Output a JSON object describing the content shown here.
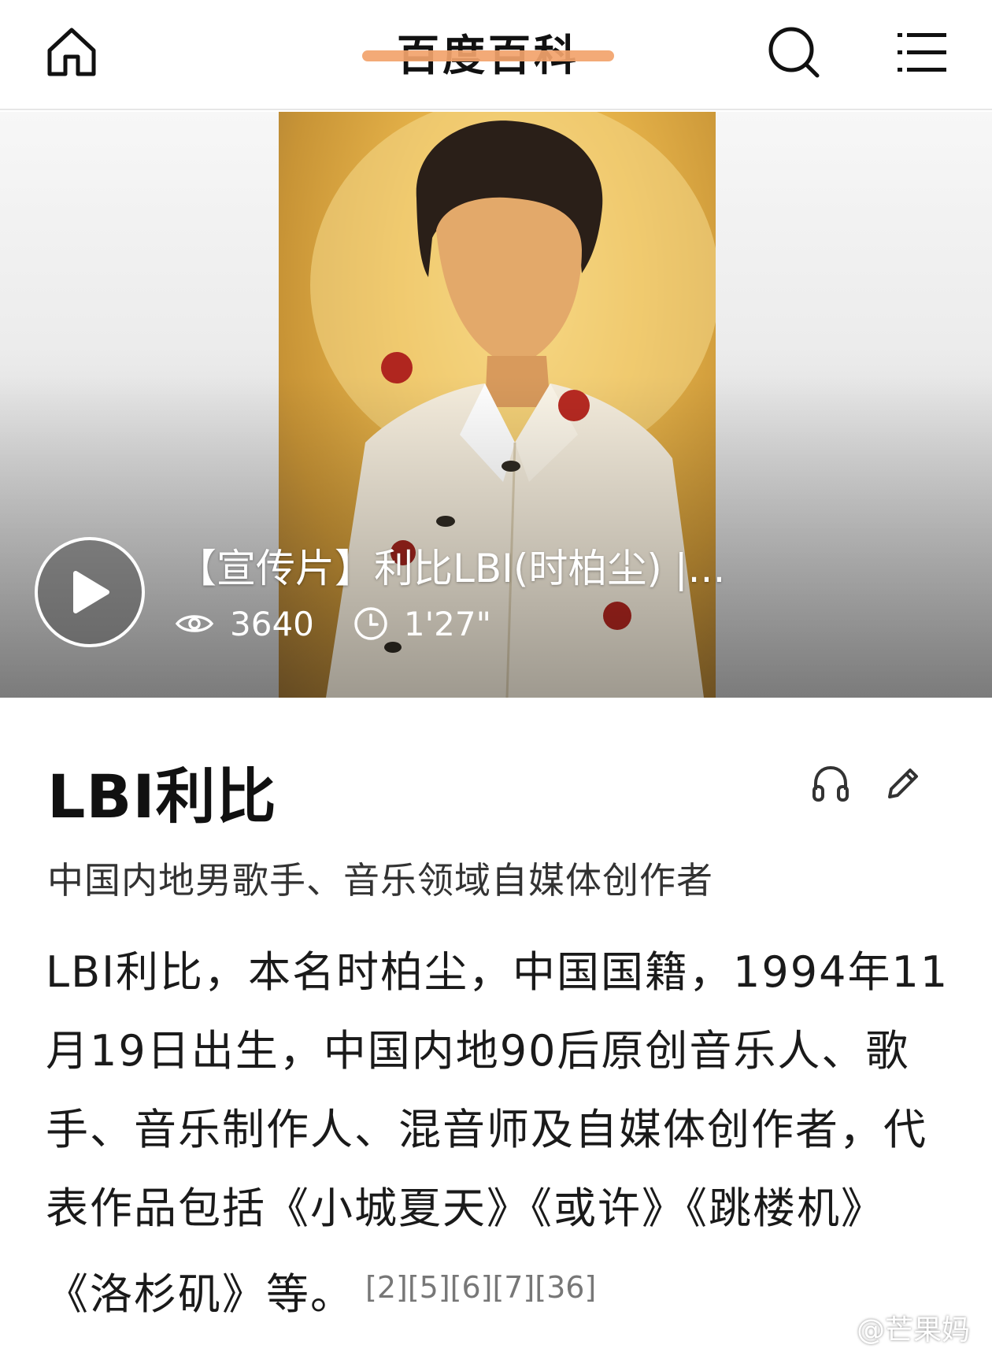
{
  "header": {
    "brand": "百度百科",
    "icons": [
      "home-icon",
      "search-icon",
      "menu-icon"
    ]
  },
  "video": {
    "title": "【宣传片】利比LBI(时柏尘) |...",
    "views": "3640",
    "duration": "1'27\""
  },
  "entry": {
    "title": "LBI利比",
    "subtitle": "中国内地男歌手、音乐领域自媒体创作者",
    "summary": "LBI利比，本名时柏尘，中国国籍，1994年11月19日出生，中国内地90后原创音乐人、歌手、音乐制作人、混音师及自媒体创作者，代表作品包括《小城夏天》《或许》《跳楼机》《洛杉矶》等。",
    "references": "[2][5][6][7][36]"
  },
  "watermark": "@芒果妈妈",
  "colors": {
    "brand_strike": "#f2a36b",
    "photo_gold": "#e9b64c",
    "text": "#1a1a1a"
  }
}
